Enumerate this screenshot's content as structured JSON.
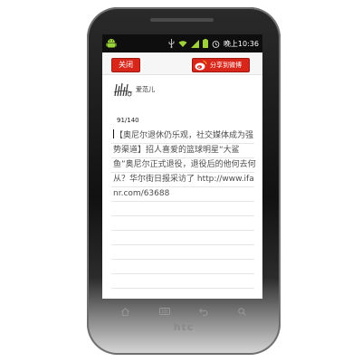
{
  "status_bar": {
    "time": "晚上10:36",
    "icons": [
      "android-icon",
      "usb-icon",
      "wifi-icon",
      "signal-icon",
      "battery-icon",
      "alarm-icon"
    ]
  },
  "title_bar": {
    "close_label": "关闭",
    "share_label": "分享到微博"
  },
  "account": {
    "name": "爱范儿",
    "avatar_icon": "ifanr-logo-icon"
  },
  "compose": {
    "char_count": "91/140",
    "text": "【奥尼尔退休仍乐观，社交媒体成为强势渠道】招人喜爱的篮球明星“大鲨鱼”奥尼尔正式退役，退役后的他何去何从？华尔街日报采访了 http://www.ifanr.com/63688"
  },
  "device": {
    "brand": "htc"
  },
  "colors": {
    "accent": "#d8261a",
    "status_bar": "#0e0e0e"
  }
}
